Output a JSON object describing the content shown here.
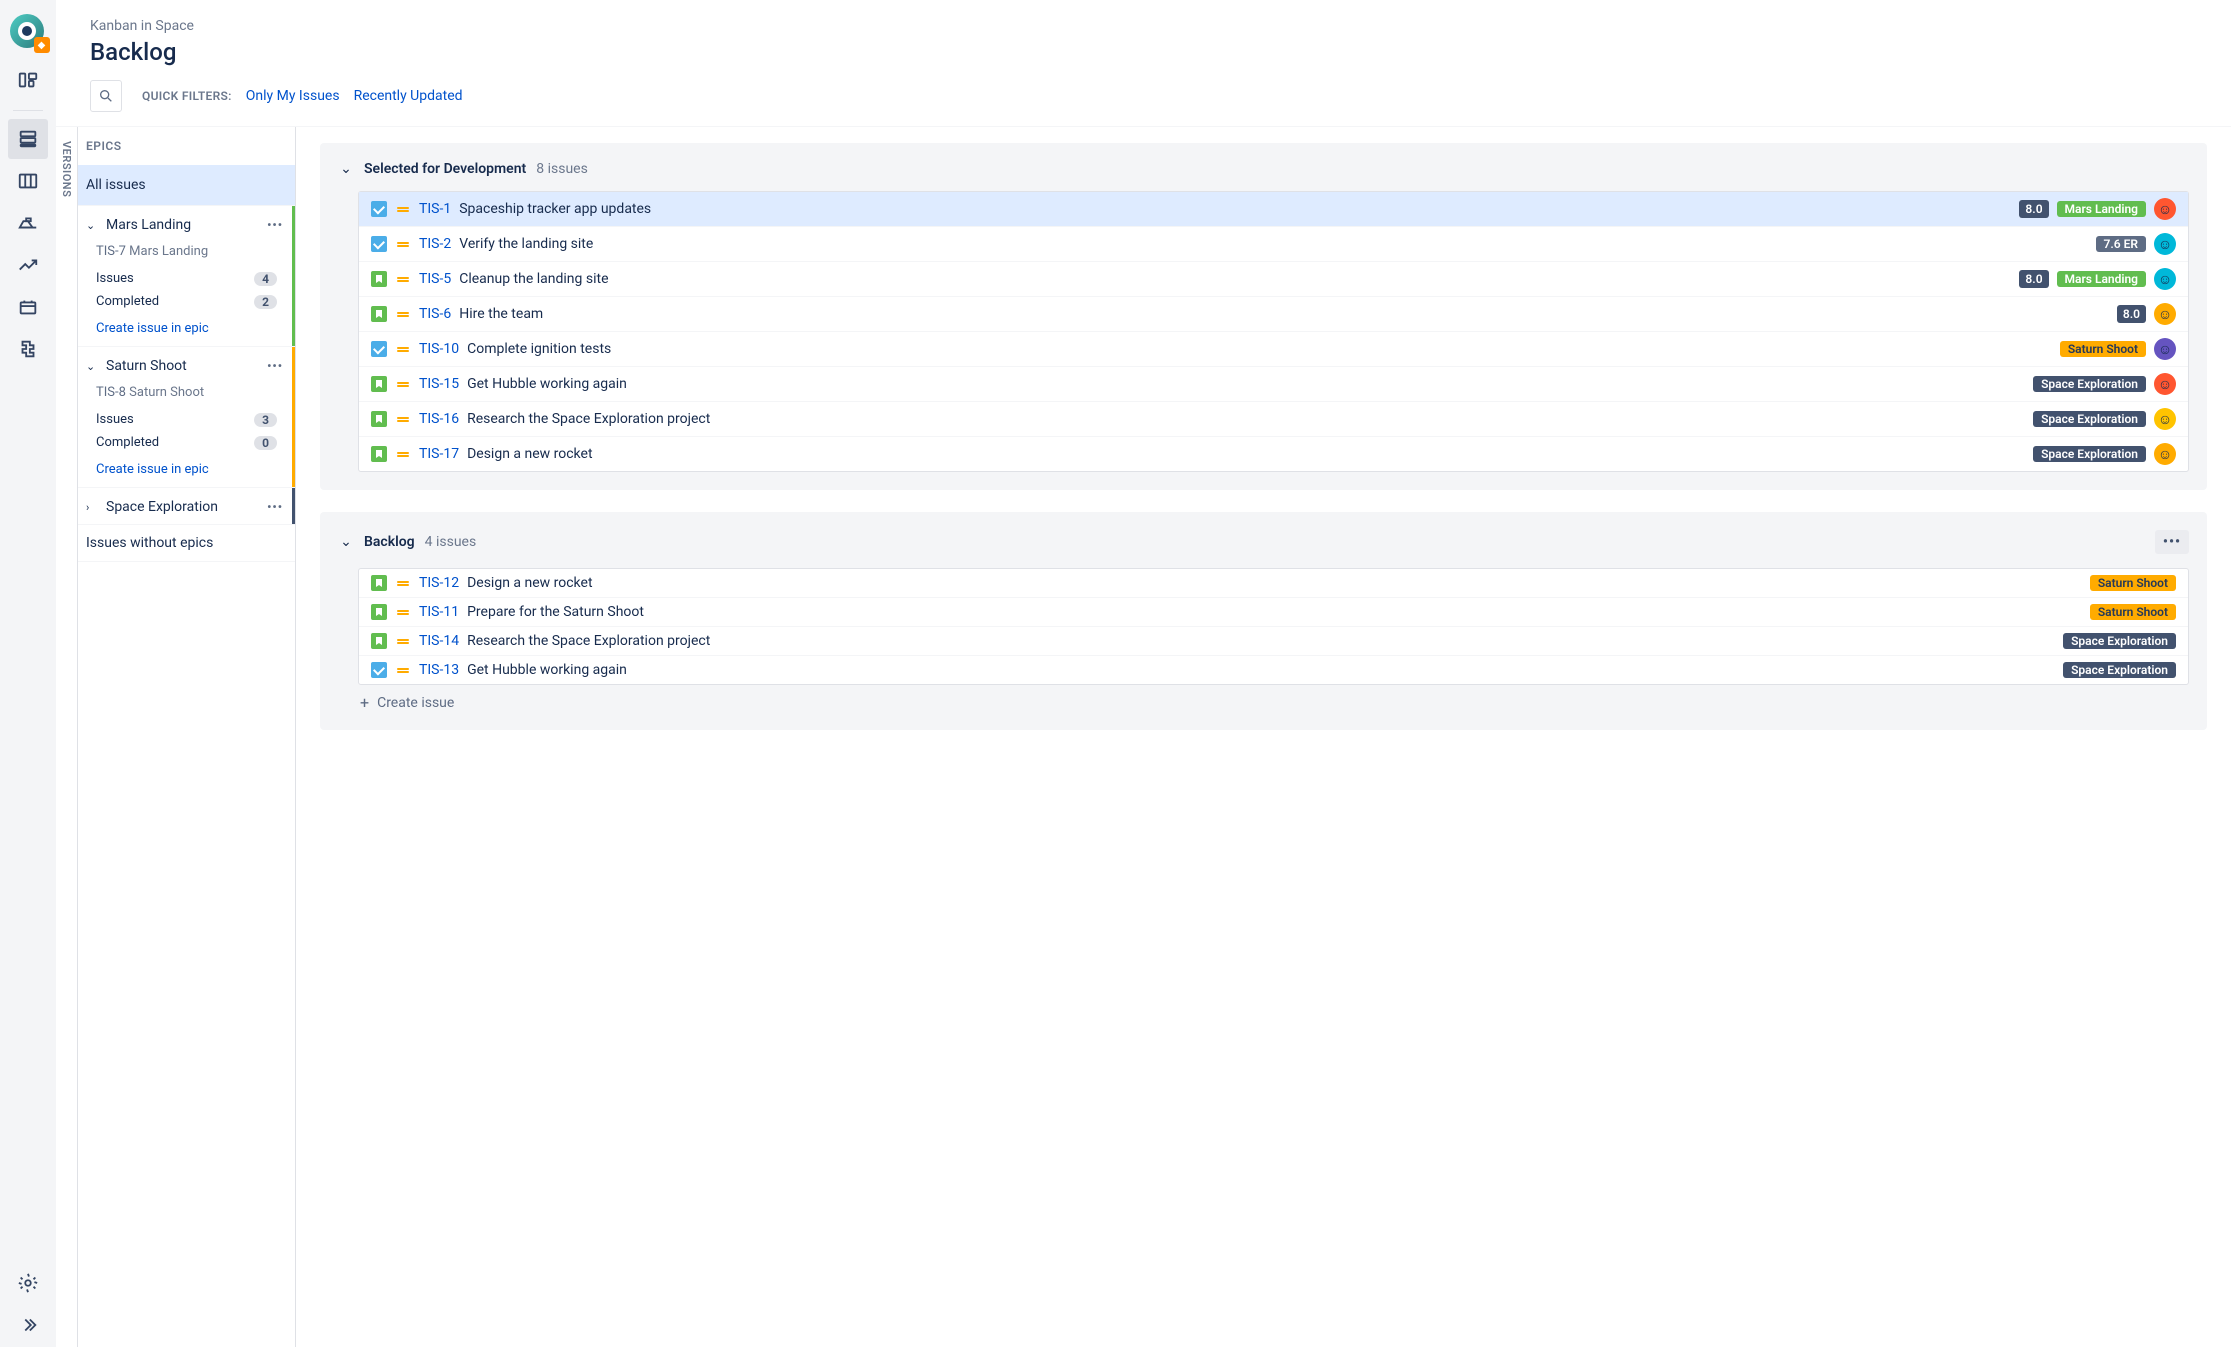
{
  "header": {
    "breadcrumb": "Kanban in Space",
    "title": "Backlog",
    "filterLabel": "Quick Filters:",
    "filters": [
      "Only My Issues",
      "Recently Updated"
    ]
  },
  "versionsTab": "VERSIONS",
  "epics": {
    "header": "EPICS",
    "allIssues": "All issues",
    "groups": [
      {
        "name": "Mars Landing",
        "key": "TIS-7",
        "expanded": true,
        "stripe": "#61bd4f",
        "stats": [
          {
            "label": "Issues",
            "count": "4"
          },
          {
            "label": "Completed",
            "count": "2"
          }
        ],
        "createLabel": "Create issue in epic"
      },
      {
        "name": "Saturn Shoot",
        "key": "TIS-8",
        "expanded": true,
        "stripe": "#ffab00",
        "stats": [
          {
            "label": "Issues",
            "count": "3"
          },
          {
            "label": "Completed",
            "count": "0"
          }
        ],
        "createLabel": "Create issue in epic"
      },
      {
        "name": "Space Exploration",
        "expanded": false,
        "stripe": "#42526e"
      }
    ],
    "noEpic": "Issues without epics"
  },
  "sections": [
    {
      "title": "Selected for Development",
      "count": "8 issues",
      "showMore": false,
      "issues": [
        {
          "type": "task",
          "key": "TIS-1",
          "summary": "Spaceship tracker app updates",
          "version": "8.0",
          "epic": {
            "label": "Mars Landing",
            "cls": "mars"
          },
          "avatar": "av-red",
          "selected": true
        },
        {
          "type": "task",
          "key": "TIS-2",
          "summary": "Verify the landing site",
          "version": "",
          "epic": {
            "label": "7.6 ER",
            "cls": "er"
          },
          "avatar": "av-teal"
        },
        {
          "type": "story",
          "key": "TIS-5",
          "summary": "Cleanup the landing site",
          "version": "8.0",
          "epic": {
            "label": "Mars Landing",
            "cls": "mars"
          },
          "avatar": "av-teal"
        },
        {
          "type": "story",
          "key": "TIS-6",
          "summary": "Hire the team",
          "version": "8.0",
          "epic": null,
          "avatar": "av-orange"
        },
        {
          "type": "task",
          "key": "TIS-10",
          "summary": "Complete ignition tests",
          "version": "",
          "epic": {
            "label": "Saturn Shoot",
            "cls": "saturn"
          },
          "avatar": "av-purple"
        },
        {
          "type": "story",
          "key": "TIS-15",
          "summary": "Get Hubble working again",
          "version": "",
          "epic": {
            "label": "Space Exploration",
            "cls": "space"
          },
          "avatar": "av-red"
        },
        {
          "type": "story",
          "key": "TIS-16",
          "summary": "Research the Space Exploration project",
          "version": "",
          "epic": {
            "label": "Space Exploration",
            "cls": "space"
          },
          "avatar": "av-yellow"
        },
        {
          "type": "story",
          "key": "TIS-17",
          "summary": "Design a new rocket",
          "version": "",
          "epic": {
            "label": "Space Exploration",
            "cls": "space"
          },
          "avatar": "av-orange"
        }
      ]
    },
    {
      "title": "Backlog",
      "count": "4 issues",
      "showMore": true,
      "issues": [
        {
          "type": "story",
          "key": "TIS-12",
          "summary": "Design a new rocket",
          "epic": {
            "label": "Saturn Shoot",
            "cls": "saturn"
          }
        },
        {
          "type": "story",
          "key": "TIS-11",
          "summary": "Prepare for the Saturn Shoot",
          "epic": {
            "label": "Saturn Shoot",
            "cls": "saturn"
          }
        },
        {
          "type": "story",
          "key": "TIS-14",
          "summary": "Research the Space Exploration project",
          "epic": {
            "label": "Space Exploration",
            "cls": "space"
          }
        },
        {
          "type": "task",
          "key": "TIS-13",
          "summary": "Get Hubble working again",
          "epic": {
            "label": "Space Exploration",
            "cls": "space"
          }
        }
      ],
      "createLabel": "Create issue"
    }
  ]
}
